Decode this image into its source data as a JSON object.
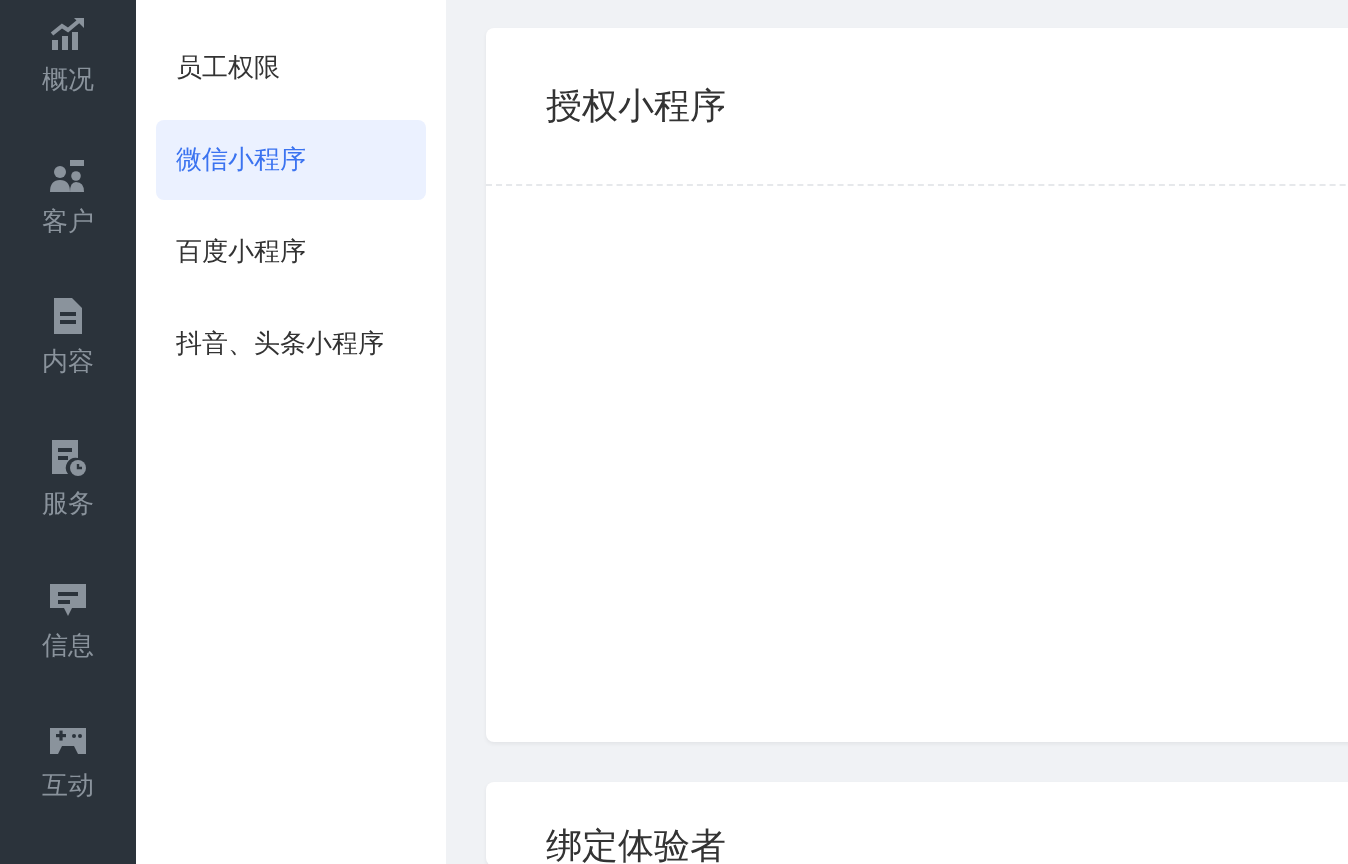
{
  "nav": [
    {
      "label": "概况"
    },
    {
      "label": "客户"
    },
    {
      "label": "内容"
    },
    {
      "label": "服务"
    },
    {
      "label": "信息"
    },
    {
      "label": "互动"
    }
  ],
  "submenu": [
    {
      "label": "员工权限",
      "selected": false
    },
    {
      "label": "微信小程序",
      "selected": true
    },
    {
      "label": "百度小程序",
      "selected": false
    },
    {
      "label": "抖音、头条小程序",
      "selected": false
    }
  ],
  "cards": [
    {
      "title": "授权小程序"
    },
    {
      "title": "绑定体验者"
    }
  ]
}
